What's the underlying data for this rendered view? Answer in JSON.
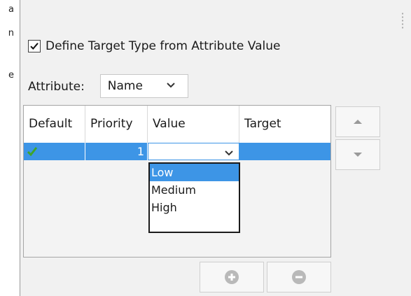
{
  "left_fragments": [
    "a",
    "n",
    "e"
  ],
  "define_target_checkbox": {
    "label": "Define Target Type from Attribute Value",
    "checked": true
  },
  "attribute": {
    "label": "Attribute:",
    "selected": "Name"
  },
  "table": {
    "columns": [
      "Default",
      "Priority",
      "Value",
      "Target"
    ],
    "rows": [
      {
        "default_icon": "green-check-icon",
        "priority": "1",
        "value": "",
        "target": ""
      }
    ]
  },
  "value_dropdown": {
    "options": [
      "Low",
      "Medium",
      "High"
    ],
    "highlighted": "Low"
  },
  "side_buttons": {
    "up": "triangle-up-icon",
    "down": "triangle-down-icon"
  },
  "bottom_buttons": {
    "add": "plus-circle-icon",
    "remove": "minus-circle-icon"
  },
  "colors": {
    "selection": "#3d95e6",
    "panel_bg": "#f1f1f1",
    "check_green": "#3fa52a"
  }
}
